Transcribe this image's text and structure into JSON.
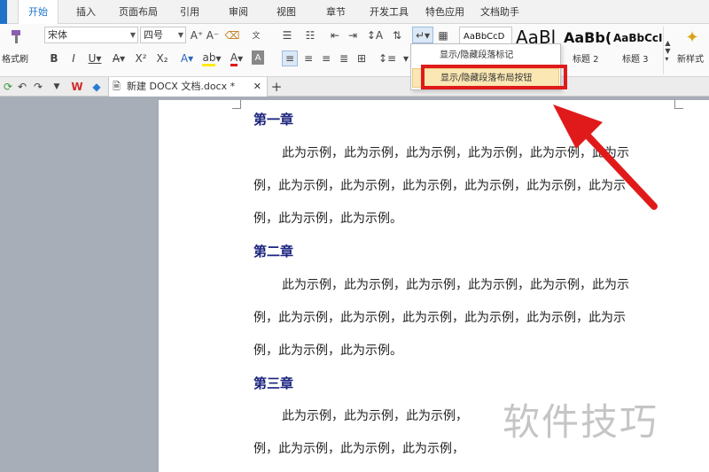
{
  "menu": {
    "tabs": [
      "开始",
      "插入",
      "页面布局",
      "引用",
      "审阅",
      "视图",
      "章节",
      "开发工具",
      "特色应用",
      "文档助手"
    ],
    "active": "开始"
  },
  "ribbon": {
    "format_painter_label": "格式刷",
    "font_name": "宋体",
    "font_size": "四号",
    "style_samples": [
      "AaBbCcD",
      "AaBl",
      "AaBb(",
      "AaBbCcI"
    ],
    "style_labels": [
      "标题 2",
      "标题 3"
    ],
    "new_style_label": "新样式"
  },
  "dropdown": {
    "items": [
      "显示/隐藏段落标记",
      "显示/隐藏段落布局按钮"
    ],
    "highlighted_index": 1
  },
  "doc_tab": {
    "title": "新建 DOCX 文档.docx *",
    "add_label": "+"
  },
  "document": {
    "chapters": [
      {
        "heading": "第一章",
        "lines": [
          "此为示例，此为示例，此为示例，此为示例，此为示例，此为示",
          "例，此为示例，此为示例，此为示例，此为示例，此为示例，此为示",
          "例，此为示例，此为示例。"
        ]
      },
      {
        "heading": "第二章",
        "lines": [
          "此为示例，此为示例，此为示例，此为示例，此为示例，此为示",
          "例，此为示例，此为示例，此为示例，此为示例，此为示例，此为示",
          "例，此为示例，此为示例。"
        ]
      },
      {
        "heading": "第三章",
        "lines": [
          "此为示例，此为示例，此为示例，",
          "例，此为示例，此为示例，此为示例，"
        ]
      }
    ]
  },
  "watermark": "软件技巧",
  "colors": {
    "accent": "#1e73c8",
    "heading": "#1a237e",
    "highlight": "#fbe7b3",
    "annotation_red": "#e01a1a"
  }
}
